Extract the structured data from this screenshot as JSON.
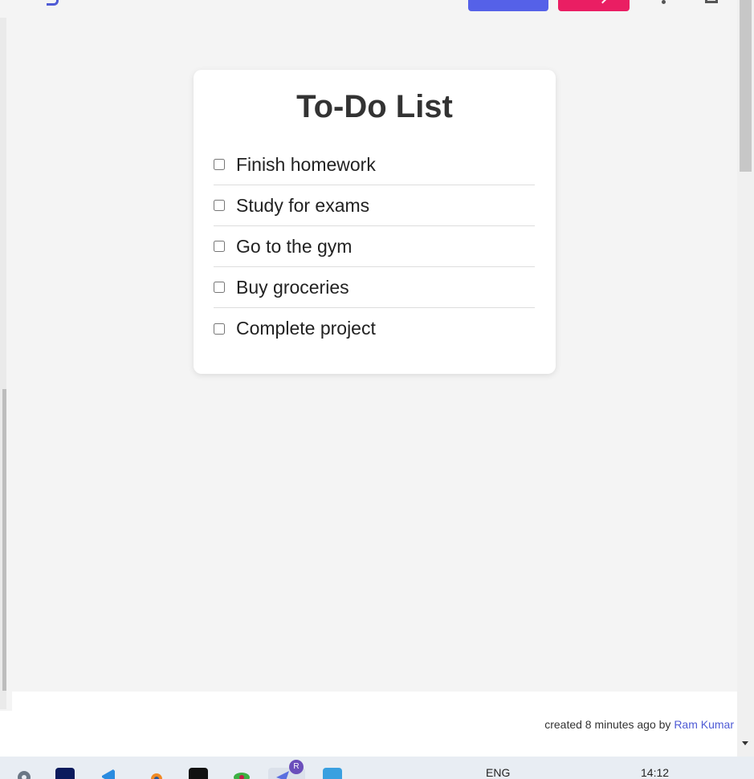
{
  "header": {
    "colors": {
      "primary_button": "#5561e8",
      "secondary_button": "#ea1e63",
      "brand": "#4f5bd5"
    }
  },
  "todo": {
    "title": "To-Do List",
    "items": [
      {
        "label": "Finish homework",
        "checked": false
      },
      {
        "label": "Study for exams",
        "checked": false
      },
      {
        "label": "Go to the gym",
        "checked": false
      },
      {
        "label": "Buy groceries",
        "checked": false
      },
      {
        "label": "Complete project",
        "checked": false
      }
    ]
  },
  "footer": {
    "created_text": "created 8 minutes ago by",
    "author": "Ram Kumar"
  },
  "taskbar": {
    "icons": [
      "settings-icon",
      "adobe-animate-icon",
      "vscode-icon",
      "blender-icon",
      "github-icon",
      "raspberry-icon",
      "messenger-icon",
      "notepad-icon"
    ],
    "language": "ENG",
    "time": "14:12",
    "notification_badge": "R"
  }
}
